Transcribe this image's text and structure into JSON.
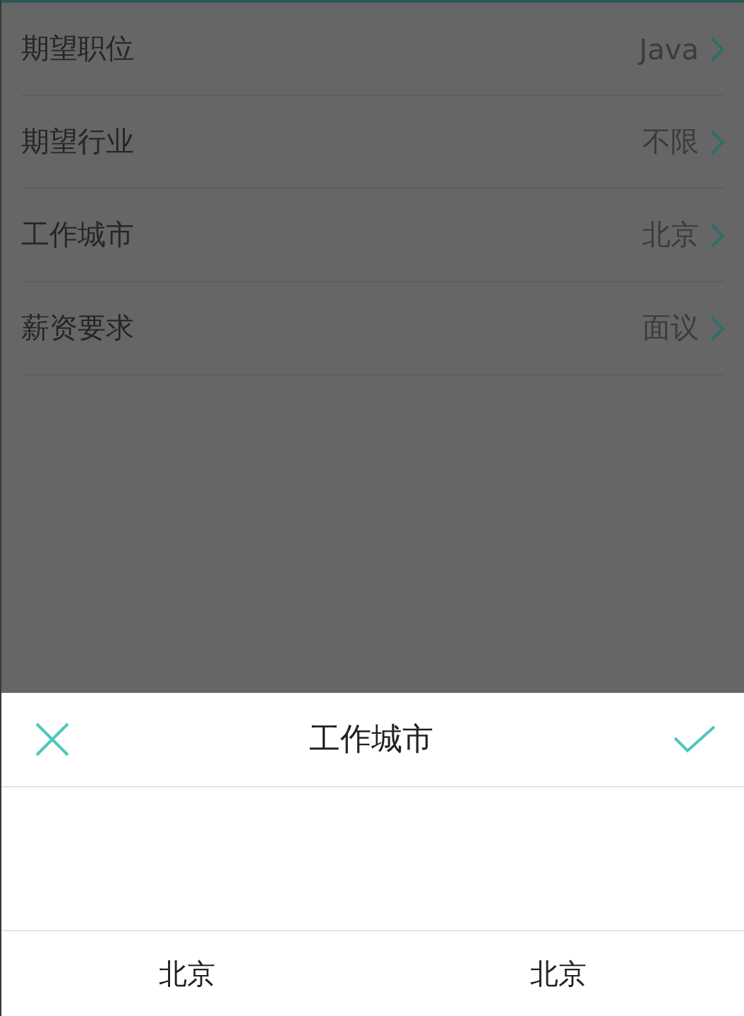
{
  "settings": [
    {
      "label": "期望职位",
      "value": "Java"
    },
    {
      "label": "期望行业",
      "value": "不限"
    },
    {
      "label": "工作城市",
      "value": "北京"
    },
    {
      "label": "薪资要求",
      "value": "面议"
    }
  ],
  "picker": {
    "title": "工作城市",
    "columns": [
      "北京",
      "北京"
    ]
  }
}
